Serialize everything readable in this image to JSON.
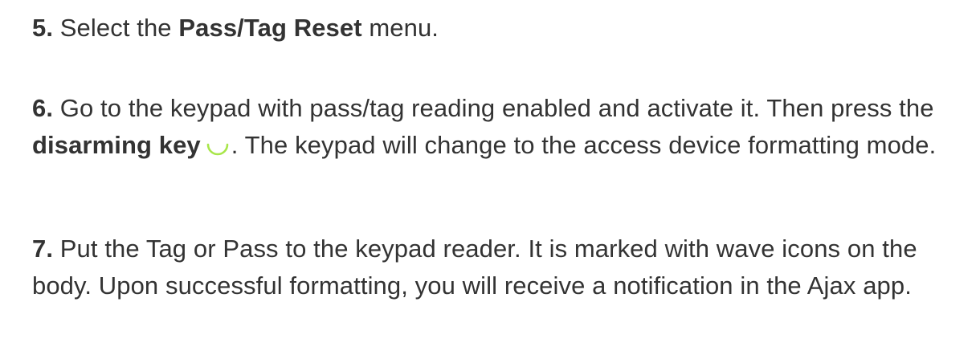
{
  "steps": [
    {
      "number": "5.",
      "text_before": "Select the ",
      "bold": "Pass/Tag Reset",
      "text_after": " menu."
    },
    {
      "number": "6.",
      "text_before": "Go to the keypad with pass/tag reading enabled and activate it. Then press the ",
      "bold": "disarming key",
      "icon": "disarm-arc-icon",
      "icon_color": "#a8e64a",
      "text_after": ". The keypad will change to the access device formatting mode."
    },
    {
      "number": "7.",
      "text": "Put the Tag or Pass to the keypad reader. It is marked with wave icons on the body. Upon successful formatting, you will receive a notification in the Ajax app."
    }
  ]
}
